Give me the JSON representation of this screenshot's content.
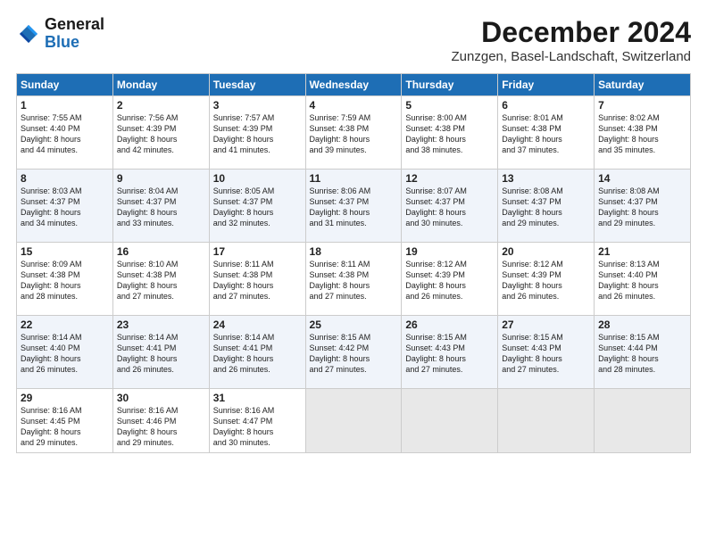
{
  "header": {
    "logo_line1": "General",
    "logo_line2": "Blue",
    "month_year": "December 2024",
    "location": "Zunzgen, Basel-Landschaft, Switzerland"
  },
  "weekdays": [
    "Sunday",
    "Monday",
    "Tuesday",
    "Wednesday",
    "Thursday",
    "Friday",
    "Saturday"
  ],
  "weeks": [
    [
      {
        "day": "1",
        "lines": [
          "Sunrise: 7:55 AM",
          "Sunset: 4:40 PM",
          "Daylight: 8 hours",
          "and 44 minutes."
        ]
      },
      {
        "day": "2",
        "lines": [
          "Sunrise: 7:56 AM",
          "Sunset: 4:39 PM",
          "Daylight: 8 hours",
          "and 42 minutes."
        ]
      },
      {
        "day": "3",
        "lines": [
          "Sunrise: 7:57 AM",
          "Sunset: 4:39 PM",
          "Daylight: 8 hours",
          "and 41 minutes."
        ]
      },
      {
        "day": "4",
        "lines": [
          "Sunrise: 7:59 AM",
          "Sunset: 4:38 PM",
          "Daylight: 8 hours",
          "and 39 minutes."
        ]
      },
      {
        "day": "5",
        "lines": [
          "Sunrise: 8:00 AM",
          "Sunset: 4:38 PM",
          "Daylight: 8 hours",
          "and 38 minutes."
        ]
      },
      {
        "day": "6",
        "lines": [
          "Sunrise: 8:01 AM",
          "Sunset: 4:38 PM",
          "Daylight: 8 hours",
          "and 37 minutes."
        ]
      },
      {
        "day": "7",
        "lines": [
          "Sunrise: 8:02 AM",
          "Sunset: 4:38 PM",
          "Daylight: 8 hours",
          "and 35 minutes."
        ]
      }
    ],
    [
      {
        "day": "8",
        "lines": [
          "Sunrise: 8:03 AM",
          "Sunset: 4:37 PM",
          "Daylight: 8 hours",
          "and 34 minutes."
        ]
      },
      {
        "day": "9",
        "lines": [
          "Sunrise: 8:04 AM",
          "Sunset: 4:37 PM",
          "Daylight: 8 hours",
          "and 33 minutes."
        ]
      },
      {
        "day": "10",
        "lines": [
          "Sunrise: 8:05 AM",
          "Sunset: 4:37 PM",
          "Daylight: 8 hours",
          "and 32 minutes."
        ]
      },
      {
        "day": "11",
        "lines": [
          "Sunrise: 8:06 AM",
          "Sunset: 4:37 PM",
          "Daylight: 8 hours",
          "and 31 minutes."
        ]
      },
      {
        "day": "12",
        "lines": [
          "Sunrise: 8:07 AM",
          "Sunset: 4:37 PM",
          "Daylight: 8 hours",
          "and 30 minutes."
        ]
      },
      {
        "day": "13",
        "lines": [
          "Sunrise: 8:08 AM",
          "Sunset: 4:37 PM",
          "Daylight: 8 hours",
          "and 29 minutes."
        ]
      },
      {
        "day": "14",
        "lines": [
          "Sunrise: 8:08 AM",
          "Sunset: 4:37 PM",
          "Daylight: 8 hours",
          "and 29 minutes."
        ]
      }
    ],
    [
      {
        "day": "15",
        "lines": [
          "Sunrise: 8:09 AM",
          "Sunset: 4:38 PM",
          "Daylight: 8 hours",
          "and 28 minutes."
        ]
      },
      {
        "day": "16",
        "lines": [
          "Sunrise: 8:10 AM",
          "Sunset: 4:38 PM",
          "Daylight: 8 hours",
          "and 27 minutes."
        ]
      },
      {
        "day": "17",
        "lines": [
          "Sunrise: 8:11 AM",
          "Sunset: 4:38 PM",
          "Daylight: 8 hours",
          "and 27 minutes."
        ]
      },
      {
        "day": "18",
        "lines": [
          "Sunrise: 8:11 AM",
          "Sunset: 4:38 PM",
          "Daylight: 8 hours",
          "and 27 minutes."
        ]
      },
      {
        "day": "19",
        "lines": [
          "Sunrise: 8:12 AM",
          "Sunset: 4:39 PM",
          "Daylight: 8 hours",
          "and 26 minutes."
        ]
      },
      {
        "day": "20",
        "lines": [
          "Sunrise: 8:12 AM",
          "Sunset: 4:39 PM",
          "Daylight: 8 hours",
          "and 26 minutes."
        ]
      },
      {
        "day": "21",
        "lines": [
          "Sunrise: 8:13 AM",
          "Sunset: 4:40 PM",
          "Daylight: 8 hours",
          "and 26 minutes."
        ]
      }
    ],
    [
      {
        "day": "22",
        "lines": [
          "Sunrise: 8:14 AM",
          "Sunset: 4:40 PM",
          "Daylight: 8 hours",
          "and 26 minutes."
        ]
      },
      {
        "day": "23",
        "lines": [
          "Sunrise: 8:14 AM",
          "Sunset: 4:41 PM",
          "Daylight: 8 hours",
          "and 26 minutes."
        ]
      },
      {
        "day": "24",
        "lines": [
          "Sunrise: 8:14 AM",
          "Sunset: 4:41 PM",
          "Daylight: 8 hours",
          "and 26 minutes."
        ]
      },
      {
        "day": "25",
        "lines": [
          "Sunrise: 8:15 AM",
          "Sunset: 4:42 PM",
          "Daylight: 8 hours",
          "and 27 minutes."
        ]
      },
      {
        "day": "26",
        "lines": [
          "Sunrise: 8:15 AM",
          "Sunset: 4:43 PM",
          "Daylight: 8 hours",
          "and 27 minutes."
        ]
      },
      {
        "day": "27",
        "lines": [
          "Sunrise: 8:15 AM",
          "Sunset: 4:43 PM",
          "Daylight: 8 hours",
          "and 27 minutes."
        ]
      },
      {
        "day": "28",
        "lines": [
          "Sunrise: 8:15 AM",
          "Sunset: 4:44 PM",
          "Daylight: 8 hours",
          "and 28 minutes."
        ]
      }
    ],
    [
      {
        "day": "29",
        "lines": [
          "Sunrise: 8:16 AM",
          "Sunset: 4:45 PM",
          "Daylight: 8 hours",
          "and 29 minutes."
        ]
      },
      {
        "day": "30",
        "lines": [
          "Sunrise: 8:16 AM",
          "Sunset: 4:46 PM",
          "Daylight: 8 hours",
          "and 29 minutes."
        ]
      },
      {
        "day": "31",
        "lines": [
          "Sunrise: 8:16 AM",
          "Sunset: 4:47 PM",
          "Daylight: 8 hours",
          "and 30 minutes."
        ]
      },
      null,
      null,
      null,
      null
    ]
  ]
}
